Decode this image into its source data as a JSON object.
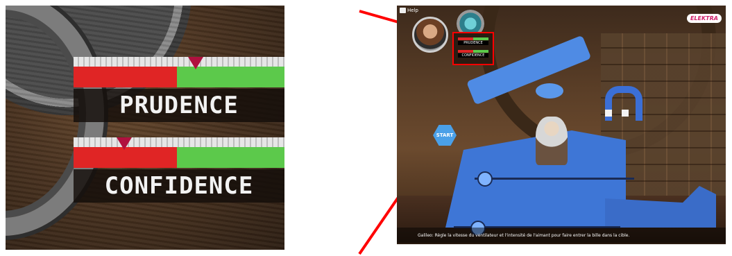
{
  "zoom_panel": {
    "gauges": [
      {
        "label": "PRUDENCE",
        "value_fraction": 0.49,
        "marker_fraction": 0.58
      },
      {
        "label": "CONFIDENCE",
        "value_fraction": 0.49,
        "marker_fraction": 0.24
      }
    ]
  },
  "game": {
    "help_label": "Help",
    "logo_text": "ELEKTRA",
    "start_label": "START",
    "mini_gauges": [
      "PRUDENCE",
      "CONFIDENCE"
    ],
    "subtitle": "Galileo: Règle la vitesse du ventilateur et l'intensité de l'aimant pour faire entrer la bille dans la cible."
  },
  "colors": {
    "highlight_red": "#ff0000",
    "gauge_red": "#e02525",
    "gauge_green": "#5cc94b",
    "marker": "#b0113f",
    "machine_blue": "#3e76d6"
  }
}
